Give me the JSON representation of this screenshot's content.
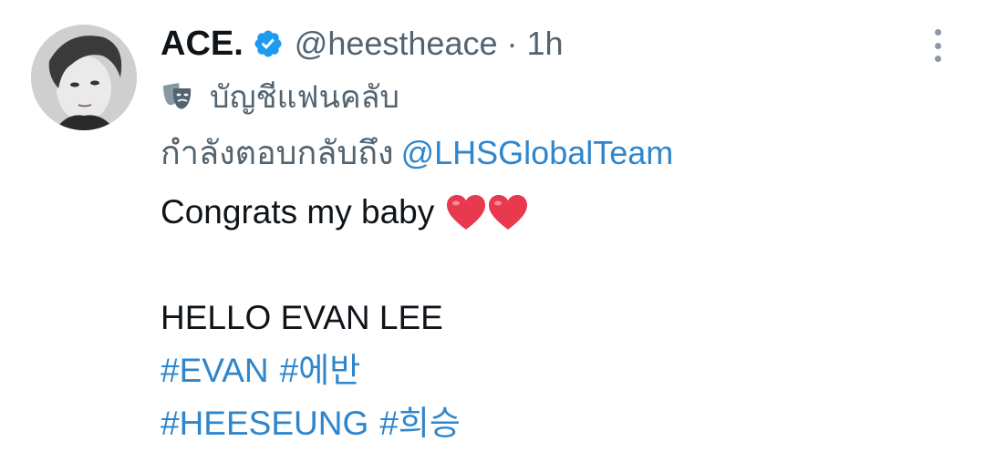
{
  "tweet": {
    "display_name": "ACE.",
    "handle": "@heestheace",
    "separator": "·",
    "time": "1h",
    "fan_account_label": "บัญชีแฟนคลับ",
    "reply_prefix": "กำลังตอบกลับถึง",
    "reply_mention": "@LHSGlobalTeam",
    "text_line1": "Congrats my baby",
    "text_line2": "HELLO EVAN LEE",
    "hashtags_line1": [
      "#EVAN",
      "#에반"
    ],
    "hashtags_line2": [
      "#HEESEUNG",
      "#희승"
    ]
  },
  "icons": {
    "verified": "verified-badge-icon",
    "fan_account": "theater-mask-icon",
    "more": "more-vertical-icon",
    "heart": "red-heart-emoji"
  },
  "colors": {
    "link": "#2f86cc",
    "secondary_text": "#536471",
    "primary_text": "#0f1419",
    "verified": "#1d9bf0",
    "heart": "#e8394f"
  }
}
